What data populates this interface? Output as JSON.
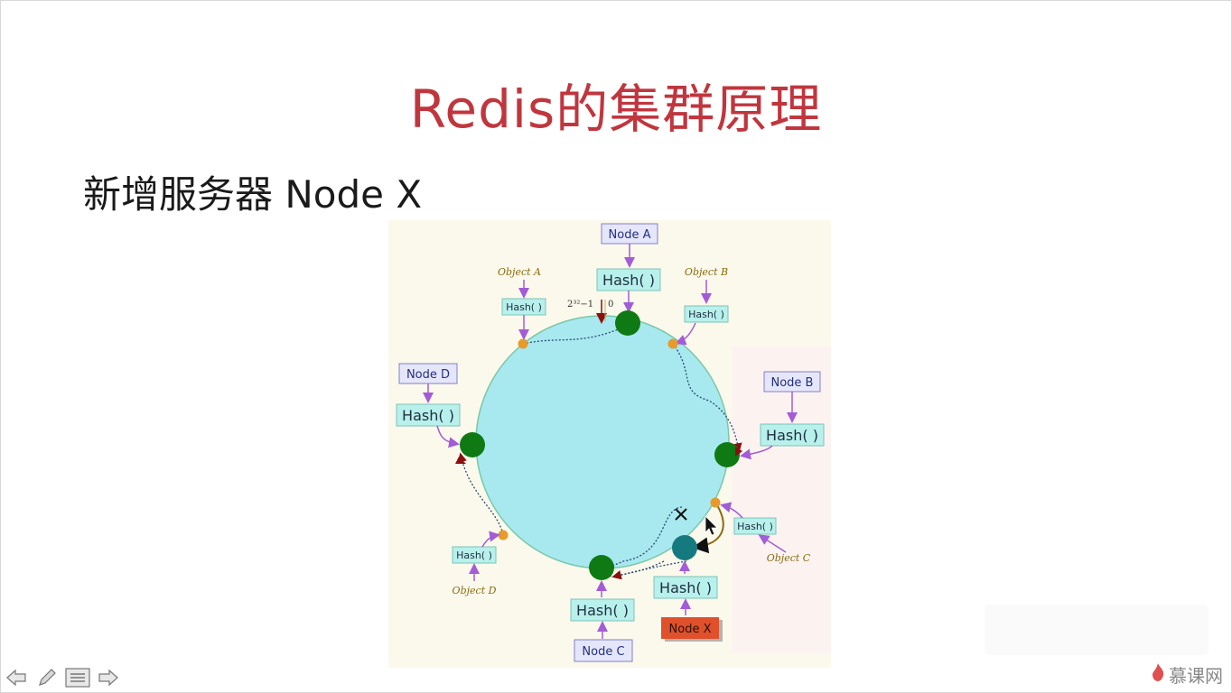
{
  "slide": {
    "title": "Redis的集群原理",
    "subtitle": "新增服务器 Node X"
  },
  "diagram": {
    "nodes": {
      "a": "Node A",
      "b": "Node B",
      "c": "Node C",
      "d": "Node D",
      "x": "Node X"
    },
    "hash_label": "Hash( )",
    "objects": {
      "a": "Object A",
      "b": "Object B",
      "c": "Object C",
      "d": "Object D"
    },
    "ring_top_label_left": "2³²−1",
    "ring_top_label_right": "0",
    "colors": {
      "ring_fill": "#a8e8ef",
      "node_dot": "#0f7a14",
      "new_node_dot": "#157a80",
      "object_dot": "#e89a2a",
      "label_fill": "#e6e6fb",
      "label_stroke": "#8080c8",
      "hash_fill": "#b8f0ec",
      "hash_stroke": "#7cc4b8",
      "arrow_purple": "#a35cd6",
      "node_x_fill": "#e0502a",
      "object_text": "#8a6a10"
    }
  },
  "footer": {
    "brand": "慕课网",
    "toolbar": [
      "back-icon",
      "pen-icon",
      "menu-icon",
      "forward-icon"
    ]
  }
}
